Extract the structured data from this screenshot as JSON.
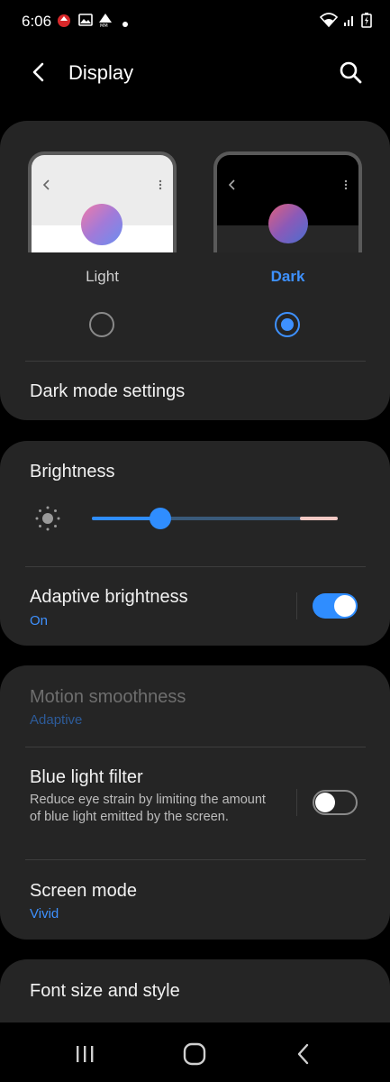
{
  "status_bar": {
    "time": "6:06",
    "left_icons": [
      "notification-badge-icon",
      "image-icon",
      "mm-icon",
      "dot-icon"
    ],
    "right_icons": [
      "wifi-icon",
      "signal-icon",
      "signal-icon",
      "battery-icon"
    ]
  },
  "app_bar": {
    "title": "Display",
    "back_icon": "chevron-left-icon",
    "search_icon": "search-icon"
  },
  "theme": {
    "options": [
      {
        "label": "Light",
        "selected": false
      },
      {
        "label": "Dark",
        "selected": true
      }
    ],
    "dark_mode_settings": "Dark mode settings"
  },
  "brightness": {
    "title": "Brightness",
    "level": 0.28,
    "adaptive": {
      "title": "Adaptive brightness",
      "status": "On",
      "enabled": true
    }
  },
  "display_options": {
    "motion": {
      "title": "Motion smoothness",
      "status": "Adaptive",
      "disabled": true
    },
    "blue_light": {
      "title": "Blue light filter",
      "description": "Reduce eye strain by limiting the amount of blue light emitted by the screen.",
      "enabled": false
    },
    "screen_mode": {
      "title": "Screen mode",
      "status": "Vivid"
    }
  },
  "font": {
    "title": "Font size and style"
  },
  "colors": {
    "accent": "#3e91ff",
    "card": "#252525",
    "background": "#000000"
  }
}
